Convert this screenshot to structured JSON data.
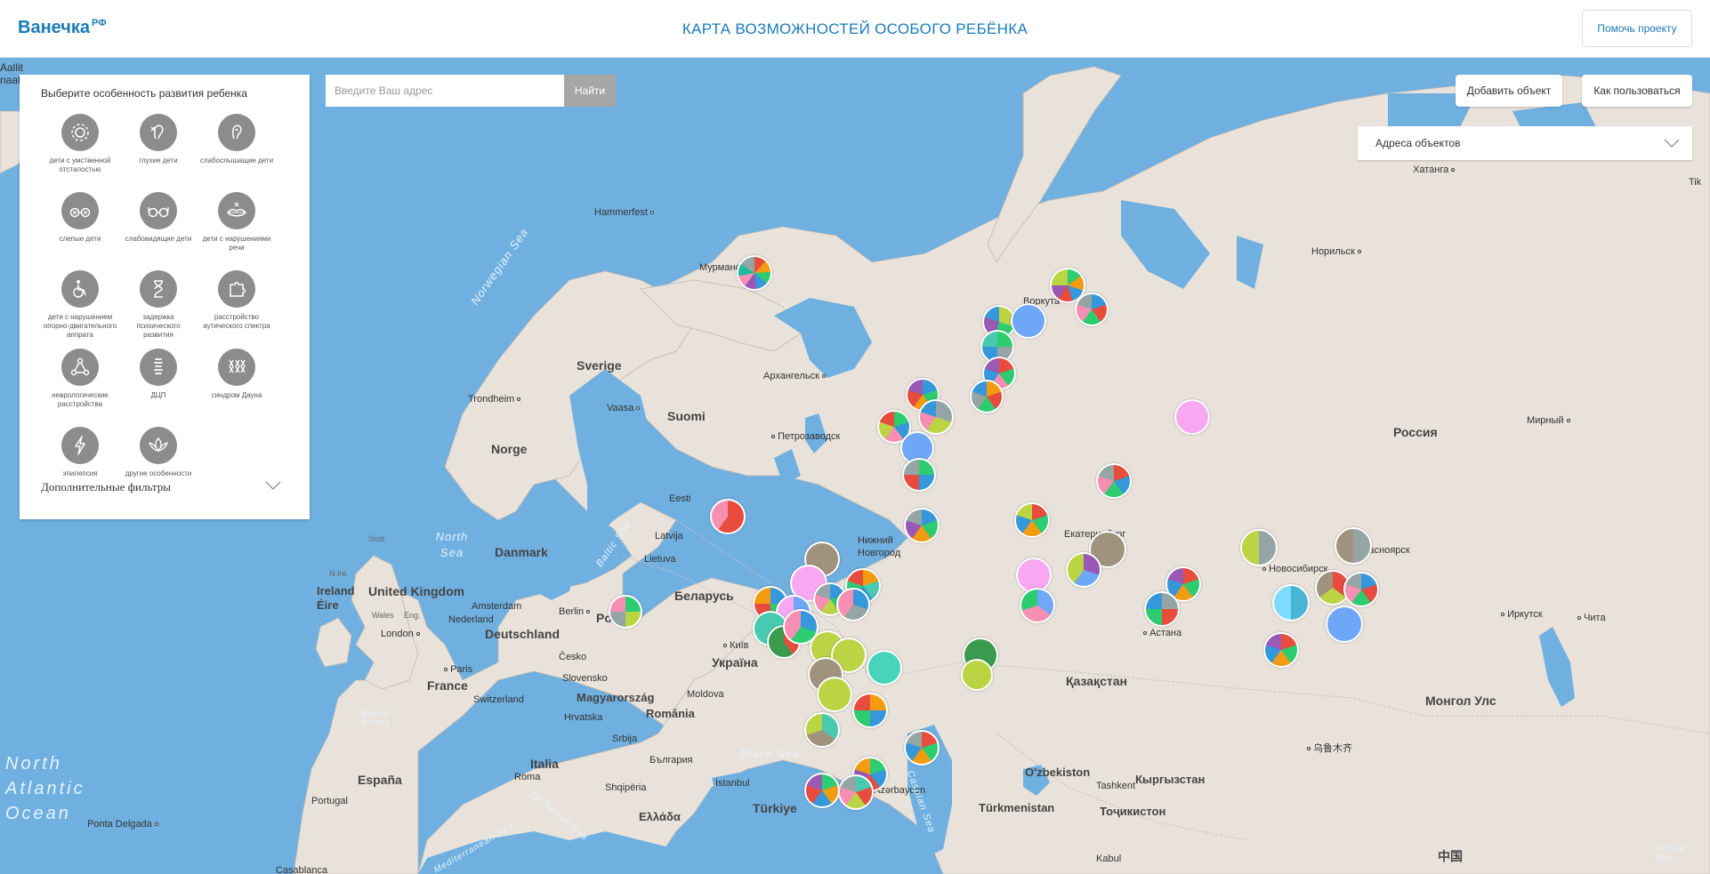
{
  "header": {
    "logo": "Ванечка",
    "logo_suffix": "РФ",
    "title": "КАРТА ВОЗМОЖНОСТЕЙ ОСОБОГО РЕБЁНКА",
    "help_button": "Помочь проекту"
  },
  "filter_panel": {
    "title": "Выберите особенность развития ребенка",
    "items": [
      {
        "label": "дети с умственной отсталостью",
        "icon": "gear-icon"
      },
      {
        "label": "глухие дети",
        "icon": "ear-crossed-icon"
      },
      {
        "label": "слабослышащие дети",
        "icon": "ear-icon"
      },
      {
        "label": "слепые дети",
        "icon": "glasses-crossed-icon"
      },
      {
        "label": "слабовидящие дети",
        "icon": "glasses-icon"
      },
      {
        "label": "дети с нарушениями речи",
        "icon": "lips-icon"
      },
      {
        "label": "дети с нарушением опорно-двигательного аппрата",
        "icon": "wheelchair-icon"
      },
      {
        "label": "задержка психического развития",
        "icon": "hourglass-icon"
      },
      {
        "label": "расстройство аутического спектра",
        "icon": "puzzle-icon"
      },
      {
        "label": "неврологические расстройства",
        "icon": "network-icon"
      },
      {
        "label": "ДЦП",
        "icon": "spine-icon"
      },
      {
        "label": "синдром Дауна",
        "icon": "chromosome-icon"
      },
      {
        "label": "эпилепсия",
        "icon": "lightning-icon"
      },
      {
        "label": "другие особенности",
        "icon": "lotus-icon"
      }
    ],
    "extra_filters": "Дополнительные фильтры"
  },
  "search": {
    "placeholder": "Введите Ваш адрес",
    "button": "Найти"
  },
  "map_controls": {
    "add_object": "Добавить объект",
    "how_to_use": "Как пользоваться",
    "address_select": "Адреса объектов",
    "zoom_in": "+",
    "zoom_out": "−"
  },
  "map_labels": {
    "countries": [
      "Россия",
      "Suomi",
      "Sverige",
      "Norge",
      "Danmark",
      "Polska",
      "Беларусь",
      "Україна",
      "Deutschland",
      "France",
      "España",
      "Italia",
      "Қазақстан",
      "Монгол Улс",
      "Türkiye",
      "United Kingdom",
      "Ireland Éire",
      "Latvija",
      "Lietuva",
      "Eesti",
      "Magyarország",
      "România",
      "Česko",
      "Nederland",
      "O'zbekiston",
      "Кыргызстан",
      "Türkmenistan",
      "Тоҷикистон",
      "Ελλάδα",
      "България",
      "Srbija",
      "Hrvatska",
      "Slovensko",
      "Moldova",
      "Switzerland",
      "Portugal",
      "Azərbaycan",
      "Shqipëria",
      "中国"
    ],
    "cities": [
      "Hammerfest",
      "Мурманск",
      "Архангельск",
      "Петрозаводск",
      "Trondheim",
      "Vaasa",
      "Воркута",
      "Норильск",
      "Хатанга",
      "Мирный",
      "Новосибирск",
      "Красноярск",
      "Иркутск",
      "Чита",
      "Екатеринбург",
      "Нижний Новгород",
      "Астана",
      "Київ",
      "Berlin",
      "Amsterdam",
      "Paris",
      "London",
      "Roma",
      "İstanbul",
      "Ponta Delgada",
      "Tashkent",
      "乌鲁木齐",
      "Kabul",
      "Casablanca",
      "Wales",
      "Eng.",
      "Scot.",
      "N.Ire.",
      "Tik",
      "Aallit naat"
    ],
    "seas": [
      "Norwegian Sea",
      "North Sea",
      "Baltic Sea",
      "Bay of Biscay",
      "Black Sea",
      "Caspian Sea",
      "Mediterranean Sea",
      "Tyrrhenian Sea",
      "Yellow Sea"
    ],
    "ocean": "North\nAtlantic\nOcean"
  },
  "colors": {
    "brand": "#1a7bb8",
    "water": "#6fb0e0",
    "land": "#e8e2da",
    "icon_bg": "#8c8c8c",
    "search_btn": "#a6a6a6"
  }
}
